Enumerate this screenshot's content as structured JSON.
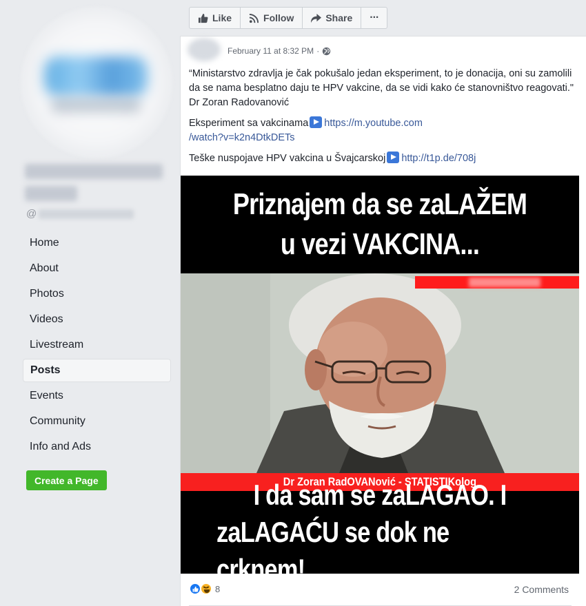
{
  "page": {
    "handle_prefix": "@"
  },
  "sidebar": {
    "items": [
      {
        "label": "Home"
      },
      {
        "label": "About"
      },
      {
        "label": "Photos"
      },
      {
        "label": "Videos"
      },
      {
        "label": "Livestream"
      },
      {
        "label": "Posts",
        "active": true
      },
      {
        "label": "Events"
      },
      {
        "label": "Community"
      },
      {
        "label": "Info and Ads"
      }
    ],
    "create_page_label": "Create a Page"
  },
  "action_bar": {
    "like_label": "Like",
    "follow_label": "Follow",
    "share_label": "Share",
    "more_label": "···"
  },
  "post": {
    "timestamp": "February 11 at 8:32 PM",
    "separator": "·",
    "quote_text": "“Ministarstvo zdravlja je čak pokušalo jedan eksperiment, to je donacija, oni su zamolili da se nama besplatno daju te HPV vakcine, da se vidi kako će stanovništvo reagovati.\" Dr Zoran Radovanović",
    "link1_prefix": "Eksperiment sa vakcinama",
    "link1_url_line1": "https://m.youtube.com",
    "link1_url_line2": "/watch?v=k2n4DtkDETs",
    "link2_prefix": "Teške nuspojave HPV vakcina u Švajcarskoj",
    "link2_url": "http://t1p.de/708j",
    "meme": {
      "top_line1": "Priznajem da se zaLAŽEM",
      "top_line2": "u vezi VAKCINA...",
      "name_strip": "Dr Zoran RadOVANović - STATISTIKolog",
      "bottom_line1": "I da sam se zaLAGAO. I",
      "bottom_line2": "zaLAGAĆU se dok ne crknem!"
    },
    "reaction_count": "8",
    "comments_label": "2 Comments"
  },
  "colors": {
    "link": "#385898",
    "create_button": "#42b72a",
    "name_strip": "#f8201f",
    "page_background": "#e9ebee"
  },
  "icons": [
    "like-thumb-icon",
    "follow-rss-icon",
    "share-arrow-icon",
    "globe-icon",
    "youtube-play-icon",
    "like-reaction-icon",
    "haha-reaction-icon"
  ]
}
